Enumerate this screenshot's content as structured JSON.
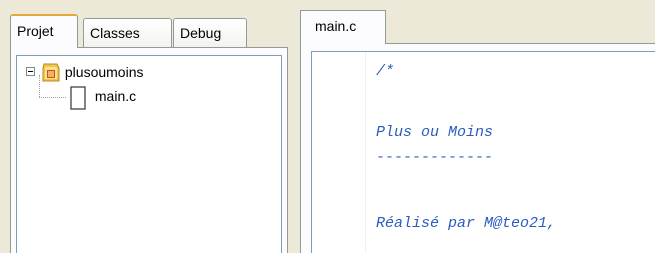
{
  "project_panel": {
    "tabs": [
      {
        "label": "Projet",
        "active": true
      },
      {
        "label": "Classes",
        "active": false
      },
      {
        "label": "Debug",
        "active": false
      }
    ],
    "tree": {
      "root": {
        "label": "plusoumoins",
        "icon": "project-folder-icon",
        "expanded": true
      },
      "children": [
        {
          "label": "main.c",
          "icon": "file-icon"
        }
      ]
    }
  },
  "editor": {
    "tab_label": "main.c",
    "comment_color": "#2a5cbf",
    "lines": [
      "/*",
      "",
      "Plus ou Moins",
      "-------------",
      "",
      "Réalisé par M@teo21,"
    ]
  }
}
